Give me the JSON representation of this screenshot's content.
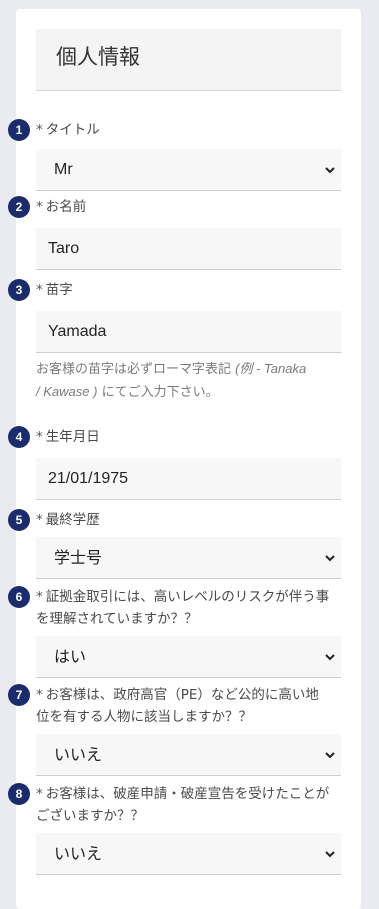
{
  "section": {
    "title": "個人情報"
  },
  "required_mark": "*",
  "fields": [
    {
      "num": "1",
      "label": "タイトル",
      "value": "Mr"
    },
    {
      "num": "2",
      "label": "お名前",
      "value": "Taro"
    },
    {
      "num": "3",
      "label": "苗字",
      "value": "Yamada"
    },
    {
      "num": "4",
      "label": "生年月日",
      "value": "21/01/1975"
    },
    {
      "num": "5",
      "label": "最終学歴",
      "value": "学士号"
    },
    {
      "num": "6",
      "label_line1": "証拠金取引には、高いレベルのリスクが伴う事",
      "label_line2": "を理解されていますか？？",
      "value": "はい"
    },
    {
      "num": "7",
      "label_line1": "お客様は、政府高官（PE）など公的に高い地",
      "label_line2": "位を有する人物に該当しますか？？",
      "value": "いいえ"
    },
    {
      "num": "8",
      "label_line1": "お客様は、破産申請・破産宣告を受けたことが",
      "label_line2": "ございますか？？",
      "value": "いいえ"
    }
  ],
  "surname_hint": {
    "text1": "お客様の苗字は必ずローマ字表記 ",
    "example_open": "(例 - ",
    "example1": "Tanaka",
    "line2_sep": "/ ",
    "example2": "Kawase",
    "example_close": " )",
    "text2": " にてご入力下さい。"
  },
  "colors": {
    "badge": "#1a2c6e",
    "field_bg": "#f7f7f7",
    "page_bg": "#eaebf0"
  },
  "icons": {
    "select": "chevron-down-icon"
  }
}
